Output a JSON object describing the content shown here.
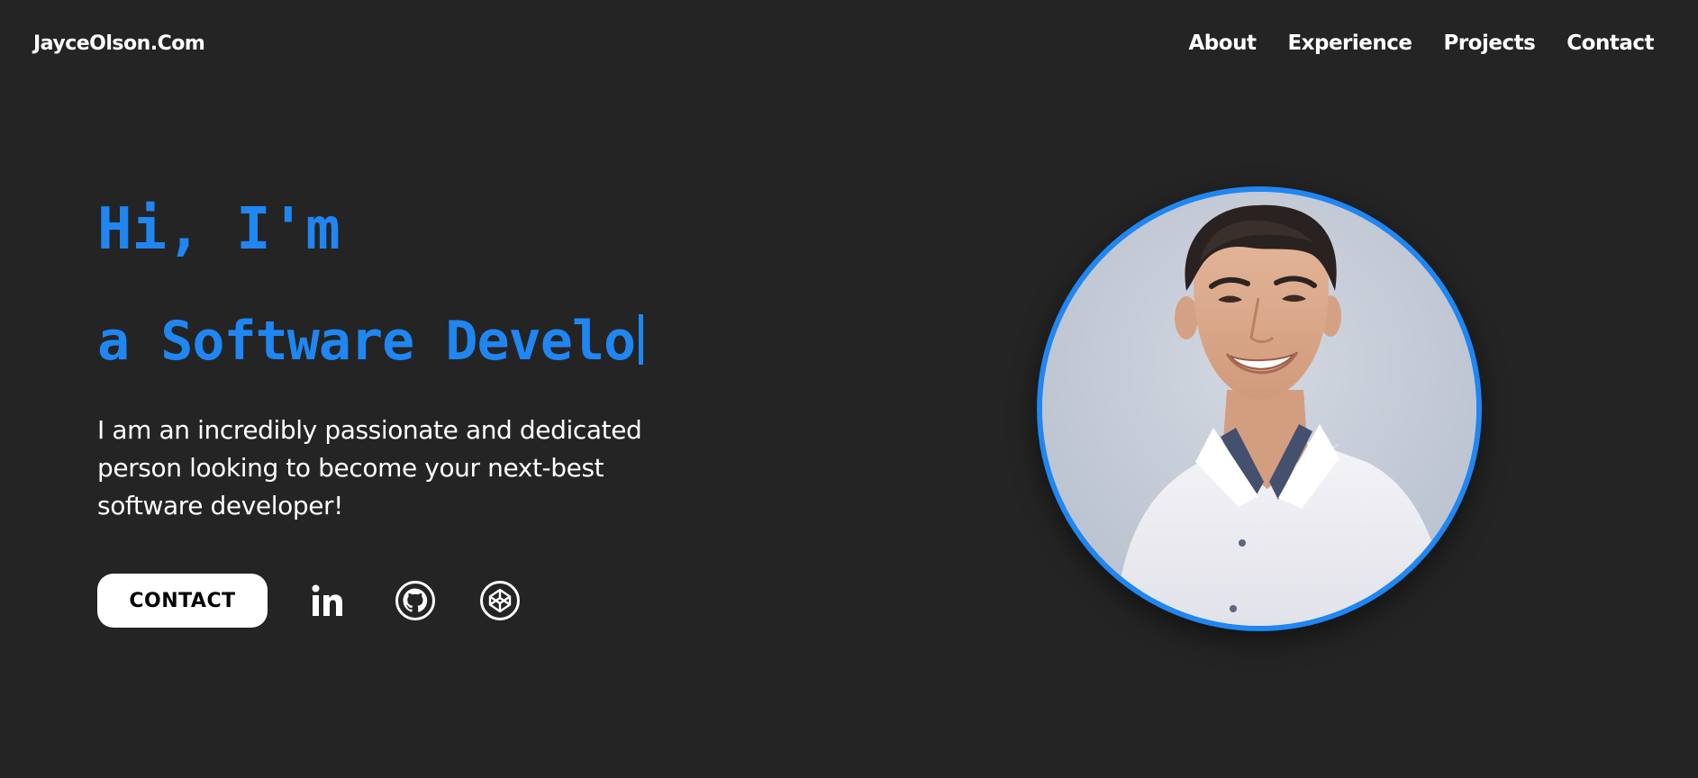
{
  "nav": {
    "brand": "JayceOlson.Com",
    "links": [
      {
        "label": "About"
      },
      {
        "label": "Experience"
      },
      {
        "label": "Projects"
      },
      {
        "label": "Contact"
      }
    ]
  },
  "hero": {
    "greeting": "Hi, I'm",
    "typed_text": "a Software Develo",
    "intro": "I am an incredibly passionate and dedicated person looking to become your next-best software developer!",
    "contact_label": "CONTACT",
    "socials": [
      {
        "icon": "linkedin-icon"
      },
      {
        "icon": "github-icon"
      },
      {
        "icon": "codepen-icon"
      }
    ]
  },
  "colors": {
    "background": "#242424",
    "accent": "#1f86f2",
    "text": "#ffffff"
  }
}
